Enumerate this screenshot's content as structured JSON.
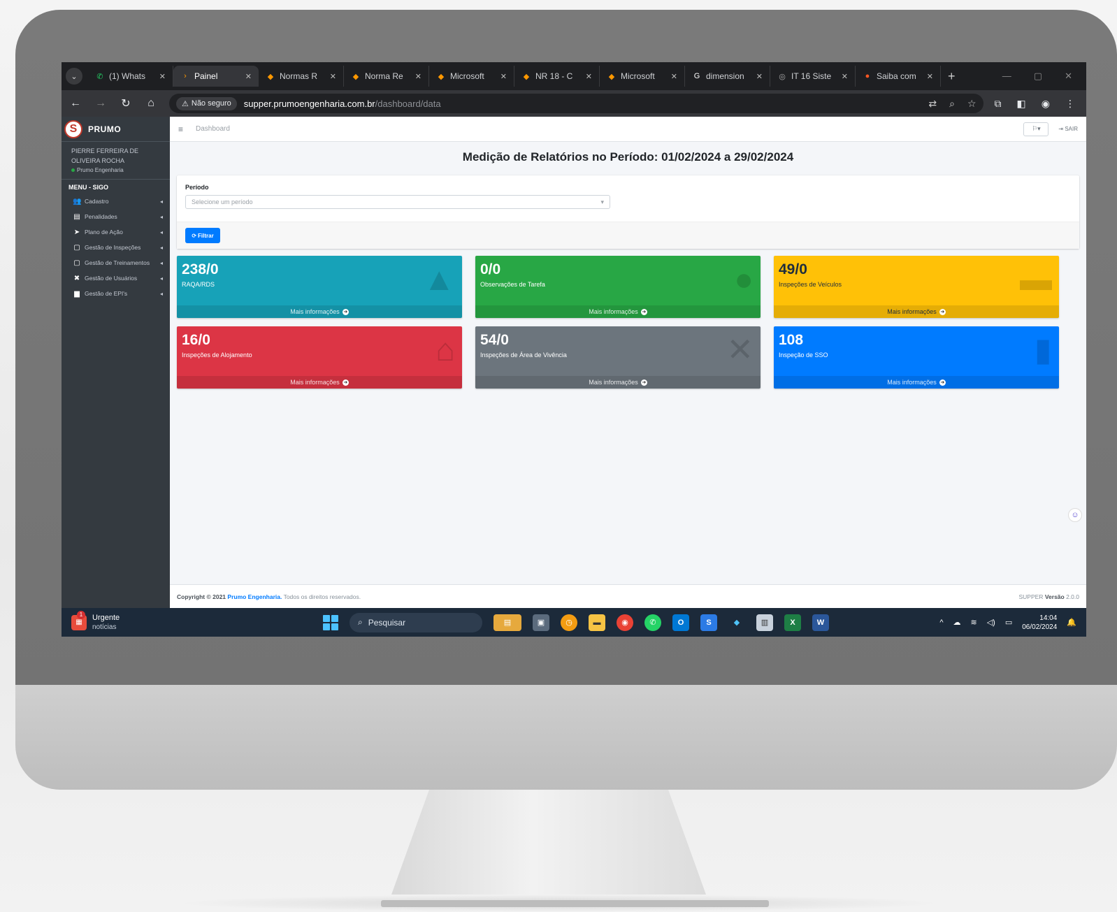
{
  "browser": {
    "tabs": [
      {
        "label": "(1) Whats",
        "icon": "whatsapp-icon",
        "color": "#25d366",
        "glyph": "✆",
        "active": false
      },
      {
        "label": "Painel",
        "icon": "site-icon",
        "color": "#ff9800",
        "glyph": "›",
        "active": true
      },
      {
        "label": "Normas R",
        "icon": "diamond-icon",
        "color": "#ff9800",
        "glyph": "◆",
        "active": false
      },
      {
        "label": "Norma Re",
        "icon": "diamond-icon",
        "color": "#ff9800",
        "glyph": "◆",
        "active": false
      },
      {
        "label": "Microsoft",
        "icon": "diamond-icon",
        "color": "#ff9800",
        "glyph": "◆",
        "active": false
      },
      {
        "label": "NR 18 - C",
        "icon": "diamond-icon",
        "color": "#ff9800",
        "glyph": "◆",
        "active": false
      },
      {
        "label": "Microsoft",
        "icon": "diamond-icon",
        "color": "#ff9800",
        "glyph": "◆",
        "active": false
      },
      {
        "label": "dimension",
        "icon": "google-icon",
        "color": "#ffffff",
        "glyph": "G",
        "active": false
      },
      {
        "label": "IT 16 Siste",
        "icon": "globe-icon",
        "color": "#aaaaaa",
        "glyph": "◎",
        "active": false
      },
      {
        "label": "Saiba com",
        "icon": "fire-icon",
        "color": "#ff5722",
        "glyph": "●",
        "active": false
      }
    ],
    "security_label": "Não seguro",
    "url_host": "supper.prumoengenharia.com.br",
    "url_path": "/dashboard/data"
  },
  "sidebar": {
    "brand": "PRUMO",
    "user_name": "PIERRE FERREIRA DE OLIVEIRA ROCHA",
    "user_company": "Prumo Engenharia",
    "menu_header": "MENU - SIGO",
    "items": [
      {
        "label": "Cadastro",
        "icon": "users-icon",
        "glyph": "👥"
      },
      {
        "label": "Penalidades",
        "icon": "file-icon",
        "glyph": "▤"
      },
      {
        "label": "Plano de Ação",
        "icon": "paper-plane-icon",
        "glyph": "➤"
      },
      {
        "label": "Gestão de Inspeções",
        "icon": "document-icon",
        "glyph": "▢"
      },
      {
        "label": "Gestão de Treinamentos",
        "icon": "document-icon",
        "glyph": "▢"
      },
      {
        "label": "Gestão de Usuários",
        "icon": "tools-icon",
        "glyph": "✖"
      },
      {
        "label": "Gestão de EPI's",
        "icon": "briefcase-icon",
        "glyph": "▆"
      }
    ]
  },
  "topnav": {
    "breadcrumb": "Dashboard",
    "logout": "SAIR"
  },
  "page": {
    "title": "Medição de Relatórios no Período: 01/02/2024 a 29/02/2024"
  },
  "filter": {
    "label": "Período",
    "placeholder": "Selecione um período",
    "button": "Filtrar"
  },
  "boxes": [
    {
      "value": "238/0",
      "caption": "RAQA/RDS",
      "link": "Mais informações",
      "color": "bg-info",
      "icon": "warning-icon",
      "glyph": "▲"
    },
    {
      "value": "0/0",
      "caption": "Observações de Tarefa",
      "link": "Mais informações",
      "color": "bg-success",
      "icon": "user-icon",
      "glyph": "●"
    },
    {
      "value": "49/0",
      "caption": "Inspeções de Veículos",
      "link": "Mais informações",
      "color": "bg-warning",
      "icon": "car-icon",
      "glyph": "▬"
    },
    {
      "value": "16/0",
      "caption": "Inspeções de Alojamento",
      "link": "Mais informações",
      "color": "bg-danger",
      "icon": "house-icon",
      "glyph": "⌂"
    },
    {
      "value": "54/0",
      "caption": "Inspeções de Área de Vivência",
      "link": "Mais informações",
      "color": "bg-secondary",
      "icon": "tools-icon",
      "glyph": "✕"
    },
    {
      "value": "108",
      "caption": "Inspeção de SSO",
      "link": "Mais informações",
      "color": "bg-primary",
      "icon": "copy-icon",
      "glyph": "▮"
    }
  ],
  "footer": {
    "copyright": "Copyright © 2021",
    "company": "Prumo Engenharia.",
    "rights": "Todos os direitos reservados.",
    "product": "SUPPER",
    "version_label": "Versão",
    "version": "2.0.0"
  },
  "taskbar": {
    "news_title": "Urgente",
    "news_sub": "notícias",
    "news_badge": "1",
    "search": "Pesquisar",
    "time": "14:04",
    "date": "06/02/2024"
  }
}
